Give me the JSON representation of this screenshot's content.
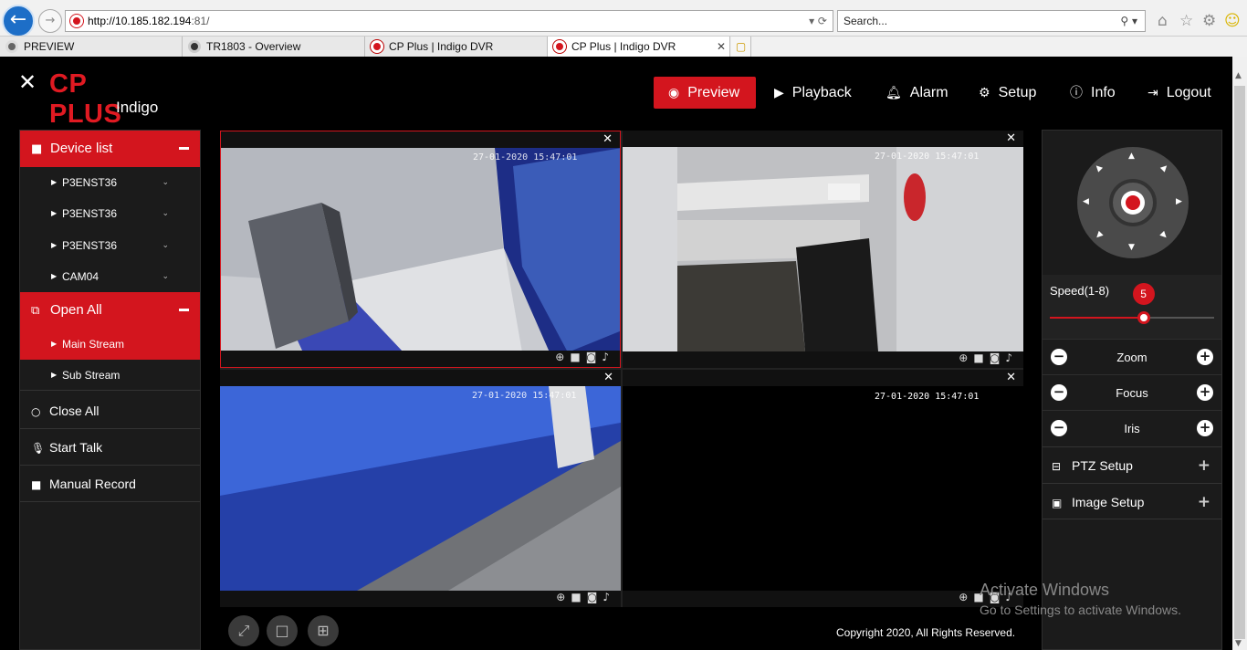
{
  "browser": {
    "url_host": "http://10.185.182.194",
    "url_port": ":81/",
    "search_placeholder": "Search...",
    "tabs": [
      {
        "label": "PREVIEW"
      },
      {
        "label": "TR1803 - Overview"
      },
      {
        "label": "CP Plus | Indigo DVR"
      },
      {
        "label": "CP Plus | Indigo DVR"
      }
    ]
  },
  "header": {
    "brand": "CP PLUS",
    "subbrand": "Indigo",
    "nav": [
      {
        "label": "Preview",
        "icon": "eye-icon"
      },
      {
        "label": "Playback",
        "icon": "play-icon"
      },
      {
        "label": "Alarm",
        "icon": "bell-icon"
      },
      {
        "label": "Setup",
        "icon": "gear-icon"
      },
      {
        "label": "Info",
        "icon": "info-icon"
      },
      {
        "label": "Logout",
        "icon": "logout-icon"
      }
    ]
  },
  "sidebar": {
    "device_list": "Device list",
    "devices": [
      "P3ENST36",
      "P3ENST36",
      "P3ENST36",
      "CAM04"
    ],
    "open_all": "Open All",
    "streams": [
      "Main Stream",
      "Sub Stream"
    ],
    "close_all": "Close All",
    "start_talk": "Start Talk",
    "manual_record": "Manual Record"
  },
  "video": {
    "channels": [
      {
        "timestamp": "27-01-2020 15:47:01"
      },
      {
        "timestamp": "27-01-2020 15:47:01"
      },
      {
        "timestamp": "27-01-2020 15:47:01"
      },
      {
        "timestamp": "27-01-2020 15:47:01"
      }
    ]
  },
  "footer": {
    "copyright": "Copyright 2020, All Rights Reserved."
  },
  "ptz": {
    "speed_label": "Speed(1-8)",
    "speed_value": "5",
    "speed_fraction": 0.57,
    "zoom": "Zoom",
    "focus": "Focus",
    "iris": "Iris",
    "ptz_setup": "PTZ Setup",
    "image_setup": "Image Setup"
  },
  "os": {
    "activate_title": "Activate Windows",
    "activate_sub": "Go to Settings to activate Windows."
  }
}
